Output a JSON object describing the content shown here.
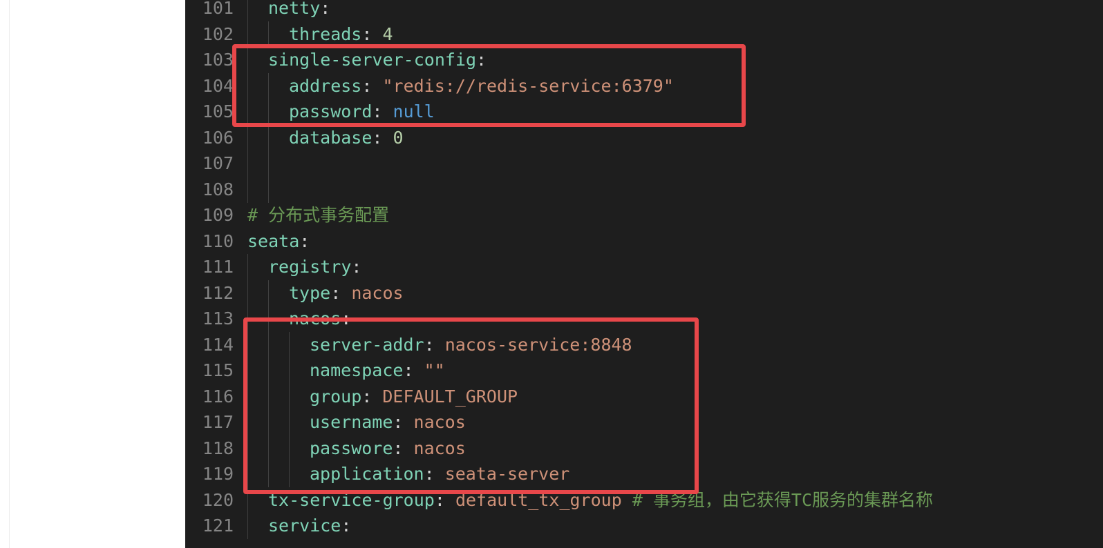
{
  "editor": {
    "lines": [
      {
        "num": "101",
        "indent": 1,
        "key": "netty",
        "colon": ":",
        "value": "",
        "vclass": "",
        "comment": ""
      },
      {
        "num": "102",
        "indent": 2,
        "key": "threads",
        "colon": ": ",
        "value": "4",
        "vclass": "n",
        "comment": ""
      },
      {
        "num": "103",
        "indent": 1,
        "key": "single-server-config",
        "colon": ":",
        "value": "",
        "vclass": "",
        "comment": ""
      },
      {
        "num": "104",
        "indent": 2,
        "key": "address",
        "colon": ": ",
        "value": "\"redis://redis-service:6379\"",
        "vclass": "s",
        "comment": ""
      },
      {
        "num": "105",
        "indent": 2,
        "key": "password",
        "colon": ": ",
        "value": "null",
        "vclass": "kw",
        "comment": ""
      },
      {
        "num": "106",
        "indent": 2,
        "key": "database",
        "colon": ": ",
        "value": "0",
        "vclass": "n",
        "comment": ""
      },
      {
        "num": "107",
        "indent": 2,
        "key": "",
        "colon": "",
        "value": "",
        "vclass": "",
        "comment": ""
      },
      {
        "num": "108",
        "indent": 2,
        "key": "",
        "colon": "",
        "value": "",
        "vclass": "",
        "comment": ""
      },
      {
        "num": "109",
        "indent": 0,
        "key": "",
        "colon": "",
        "value": "",
        "vclass": "",
        "comment": "# 分布式事务配置"
      },
      {
        "num": "110",
        "indent": 0,
        "key": "seata",
        "colon": ":",
        "value": "",
        "vclass": "",
        "comment": ""
      },
      {
        "num": "111",
        "indent": 1,
        "key": "registry",
        "colon": ":",
        "value": "",
        "vclass": "",
        "comment": ""
      },
      {
        "num": "112",
        "indent": 2,
        "key": "type",
        "colon": ": ",
        "value": "nacos",
        "vclass": "s",
        "comment": ""
      },
      {
        "num": "113",
        "indent": 2,
        "key": "nacos",
        "colon": ":",
        "value": "",
        "vclass": "",
        "comment": ""
      },
      {
        "num": "114",
        "indent": 3,
        "key": "server-addr",
        "colon": ": ",
        "value": "nacos-service:8848",
        "vclass": "s",
        "comment": ""
      },
      {
        "num": "115",
        "indent": 3,
        "key": "namespace",
        "colon": ": ",
        "value": "\"\"",
        "vclass": "s",
        "comment": ""
      },
      {
        "num": "116",
        "indent": 3,
        "key": "group",
        "colon": ": ",
        "value": "DEFAULT_GROUP",
        "vclass": "s",
        "comment": ""
      },
      {
        "num": "117",
        "indent": 3,
        "key": "username",
        "colon": ": ",
        "value": "nacos",
        "vclass": "s",
        "comment": ""
      },
      {
        "num": "118",
        "indent": 3,
        "key": "passwore",
        "colon": ": ",
        "value": "nacos",
        "vclass": "s",
        "comment": ""
      },
      {
        "num": "119",
        "indent": 3,
        "key": "application",
        "colon": ": ",
        "value": "seata-server",
        "vclass": "s",
        "comment": ""
      },
      {
        "num": "120",
        "indent": 1,
        "key": "tx-service-group",
        "colon": ": ",
        "value": "default_tx_group ",
        "vclass": "s",
        "comment": "# 事务组，由它获得TC服务的集群名称"
      },
      {
        "num": "121",
        "indent": 1,
        "key": "service",
        "colon": ":",
        "value": "",
        "vclass": "",
        "comment": ""
      }
    ]
  },
  "colors": {
    "editor_bg": "#1e1e1e",
    "highlight": "#e8474a"
  }
}
